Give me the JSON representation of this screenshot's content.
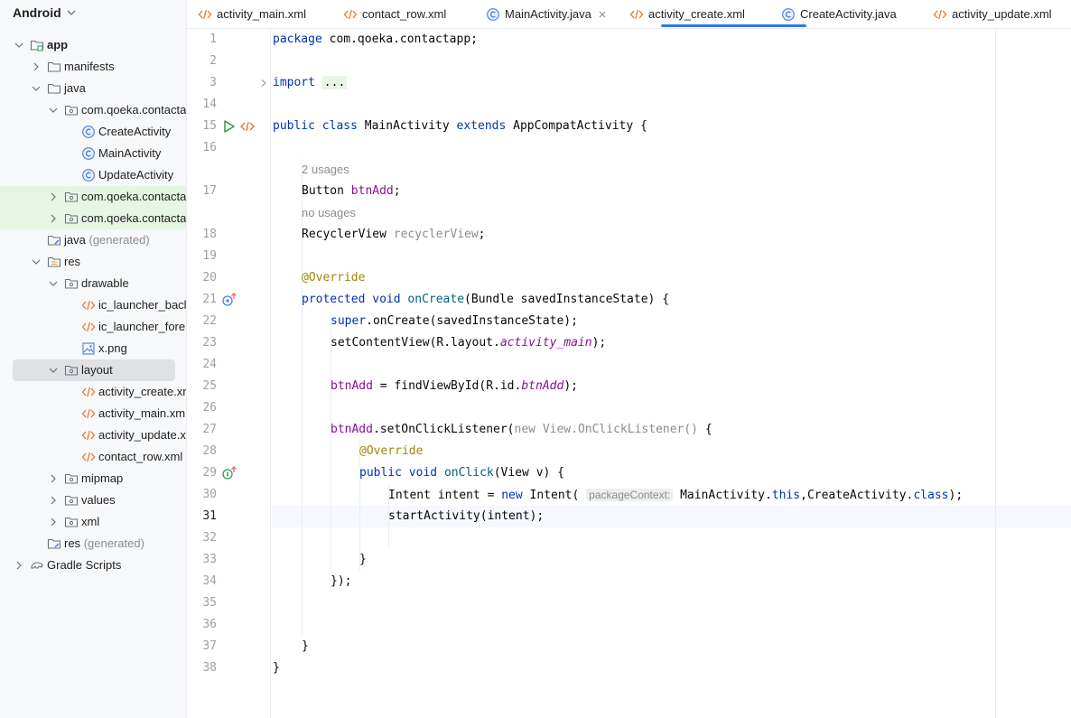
{
  "sidebar": {
    "view_mode": "Android",
    "tree": [
      {
        "label": "app",
        "sub": "",
        "level": 0,
        "icon": "module-folder-icon",
        "expanded": true,
        "bold": true
      },
      {
        "label": "manifests",
        "sub": "",
        "level": 1,
        "icon": "folder-icon",
        "expanded": false
      },
      {
        "label": "java",
        "sub": "",
        "level": 1,
        "icon": "folder-icon",
        "expanded": true
      },
      {
        "label": "com.qoeka.contacta",
        "sub": "",
        "level": 2,
        "icon": "package-icon",
        "expanded": true
      },
      {
        "label": "CreateActivity",
        "sub": "",
        "level": 3,
        "icon": "class-icon"
      },
      {
        "label": "MainActivity",
        "sub": "",
        "level": 3,
        "icon": "class-icon"
      },
      {
        "label": "UpdateActivity",
        "sub": "",
        "level": 3,
        "icon": "class-icon"
      },
      {
        "label": "com.qoeka.contacta",
        "sub": "",
        "level": 2,
        "icon": "package-icon",
        "expanded": false,
        "highlight": true
      },
      {
        "label": "com.qoeka.contacta",
        "sub": "",
        "level": 2,
        "icon": "package-icon",
        "expanded": false,
        "highlight": true
      },
      {
        "label": "java",
        "sub": "(generated)",
        "level": 1,
        "icon": "generated-folder-icon"
      },
      {
        "label": "res",
        "sub": "",
        "level": 1,
        "icon": "res-folder-icon",
        "expanded": true
      },
      {
        "label": "drawable",
        "sub": "",
        "level": 2,
        "icon": "package-icon",
        "expanded": true
      },
      {
        "label": "ic_launcher_bacl",
        "sub": "",
        "level": 3,
        "icon": "xml-icon"
      },
      {
        "label": "ic_launcher_fore",
        "sub": "",
        "level": 3,
        "icon": "xml-icon"
      },
      {
        "label": "x.png",
        "sub": "",
        "level": 3,
        "icon": "image-icon"
      },
      {
        "label": "layout",
        "sub": "",
        "level": 2,
        "icon": "package-icon",
        "expanded": true,
        "selected": true
      },
      {
        "label": "activity_create.xn",
        "sub": "",
        "level": 3,
        "icon": "xml-icon"
      },
      {
        "label": "activity_main.xml",
        "sub": "",
        "level": 3,
        "icon": "xml-icon"
      },
      {
        "label": "activity_update.x",
        "sub": "",
        "level": 3,
        "icon": "xml-icon"
      },
      {
        "label": "contact_row.xml",
        "sub": "",
        "level": 3,
        "icon": "xml-icon"
      },
      {
        "label": "mipmap",
        "sub": "",
        "level": 2,
        "icon": "package-icon",
        "expanded": false
      },
      {
        "label": "values",
        "sub": "",
        "level": 2,
        "icon": "package-icon",
        "expanded": false
      },
      {
        "label": "xml",
        "sub": "",
        "level": 2,
        "icon": "package-icon",
        "expanded": false
      },
      {
        "label": "res",
        "sub": "(generated)",
        "level": 1,
        "icon": "generated-folder-icon"
      },
      {
        "label": "Gradle Scripts",
        "sub": "",
        "level": 0,
        "icon": "gradle-icon",
        "expanded": false
      }
    ]
  },
  "tabs": [
    {
      "label": "activity_main.xml",
      "icon": "xml-icon"
    },
    {
      "label": "contact_row.xml",
      "icon": "xml-icon"
    },
    {
      "label": "MainActivity.java",
      "icon": "class-icon",
      "active": true
    },
    {
      "label": "activity_create.xml",
      "icon": "xml-icon"
    },
    {
      "label": "CreateActivity.java",
      "icon": "class-icon"
    },
    {
      "label": "activity_update.xml",
      "icon": "xml-icon"
    }
  ],
  "editor": {
    "current_line": 31,
    "line_numbers": [
      "1",
      "2",
      "3",
      "14",
      "15",
      "16",
      "",
      "17",
      "",
      "18",
      "19",
      "20",
      "21",
      "22",
      "23",
      "24",
      "25",
      "26",
      "27",
      "28",
      "29",
      "30",
      "31",
      "32",
      "33",
      "34",
      "35",
      "36",
      "37",
      "38"
    ],
    "hints": {
      "usages_2": "2 usages",
      "usages_0": "no usages",
      "param_hint": "packageContext:"
    },
    "code": {
      "l1_kw": "package",
      "l1_rest": " com.qoeka.contactapp;",
      "l3_kw": "import",
      "l3_fold": "...",
      "l15_kw1": "public",
      "l15_kw2": "class",
      "l15_name": "MainActivity",
      "l15_kw3": "extends",
      "l15_rest": "AppCompatActivity {",
      "l17_type": "Button",
      "l17_field": "btnAdd",
      "l17_end": ";",
      "l18_type": "RecyclerView",
      "l18_field": "recyclerView",
      "l18_end": ";",
      "l20_ann": "@Override",
      "l21_kw1": "protected",
      "l21_kw2": "void",
      "l21_method": "onCreate",
      "l21_rest": "(Bundle savedInstanceState) {",
      "l22_kw": "super",
      "l22_rest": ".onCreate(savedInstanceState);",
      "l23_a": "setContentView(R.layout.",
      "l23_field": "activity_main",
      "l23_b": ");",
      "l25_field": "btnAdd",
      "l25_a": " = findViewById(R.id.",
      "l25_field2": "btnAdd",
      "l25_b": ");",
      "l27_field": "btnAdd",
      "l27_a": ".setOnClickListener(",
      "l27_unused": "new View.OnClickListener()",
      "l27_b": " {",
      "l28_ann": "@Override",
      "l29_kw1": "public",
      "l29_kw2": "void",
      "l29_method": "onClick",
      "l29_rest": "(View v) {",
      "l30_a": "Intent intent = ",
      "l30_kw": "new",
      "l30_b": " Intent(",
      "l30_c": "MainActivity.",
      "l30_kw2": "this",
      "l30_d": ",CreateActivity.",
      "l30_kw3": "class",
      "l30_e": ");",
      "l31": "startActivity(intent);",
      "l33": "}",
      "l34": "});",
      "l37": "}",
      "l38": "}"
    }
  },
  "colors": {
    "keyword": "#0033b3",
    "field": "#871094",
    "annotation": "#9e880d",
    "line_number": "#9da0a8",
    "tab_underline": "#3574f0",
    "run_icon": "#369650",
    "xml_icon": "#e57a29",
    "class_icon": "#4a7bde"
  }
}
